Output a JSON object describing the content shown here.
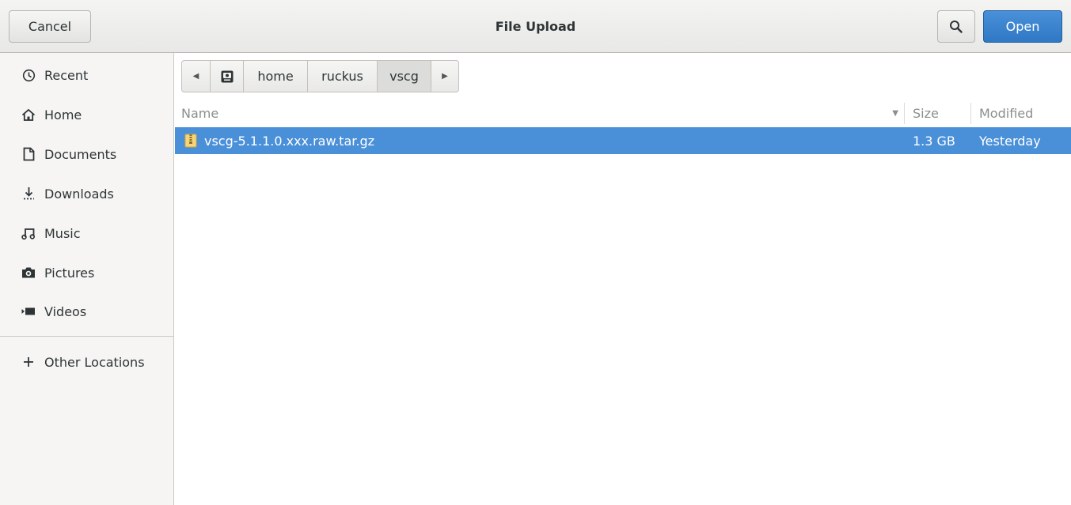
{
  "header": {
    "cancel_label": "Cancel",
    "title": "File Upload",
    "search_icon": "search-icon",
    "open_label": "Open"
  },
  "sidebar": {
    "items": [
      {
        "label": "Recent",
        "icon": "clock-icon"
      },
      {
        "label": "Home",
        "icon": "home-icon"
      },
      {
        "label": "Documents",
        "icon": "document-icon"
      },
      {
        "label": "Downloads",
        "icon": "download-icon"
      },
      {
        "label": "Music",
        "icon": "music-icon"
      },
      {
        "label": "Pictures",
        "icon": "camera-icon"
      },
      {
        "label": "Videos",
        "icon": "video-icon"
      }
    ],
    "other_locations": {
      "label": "Other Locations",
      "icon": "plus-icon"
    }
  },
  "pathbar": {
    "segments": [
      "home",
      "ruckus",
      "vscg"
    ],
    "active": "vscg"
  },
  "filelist": {
    "columns": {
      "name": "Name",
      "size": "Size",
      "modified": "Modified"
    },
    "rows": [
      {
        "name": "vscg-5.1.1.0.xxx.raw.tar.gz",
        "size": "1.3 GB",
        "modified": "Yesterday",
        "selected": true
      }
    ]
  },
  "colors": {
    "accent": "#4a90d9",
    "sidebar_bg": "#f6f5f4"
  }
}
